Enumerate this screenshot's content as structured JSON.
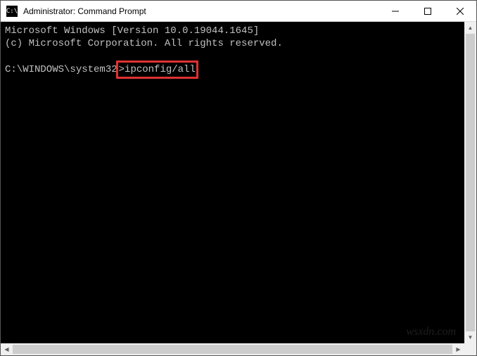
{
  "window": {
    "title": "Administrator: Command Prompt",
    "icon_label": "C:\\"
  },
  "terminal": {
    "line1": "Microsoft Windows [Version 10.0.19044.1645]",
    "line2": "(c) Microsoft Corporation. All rights reserved.",
    "blank": "",
    "prompt": "C:\\WINDOWS\\system32",
    "prompt_symbol": ">",
    "command": "ipconfig/all"
  },
  "watermark": "wsxdn.com"
}
